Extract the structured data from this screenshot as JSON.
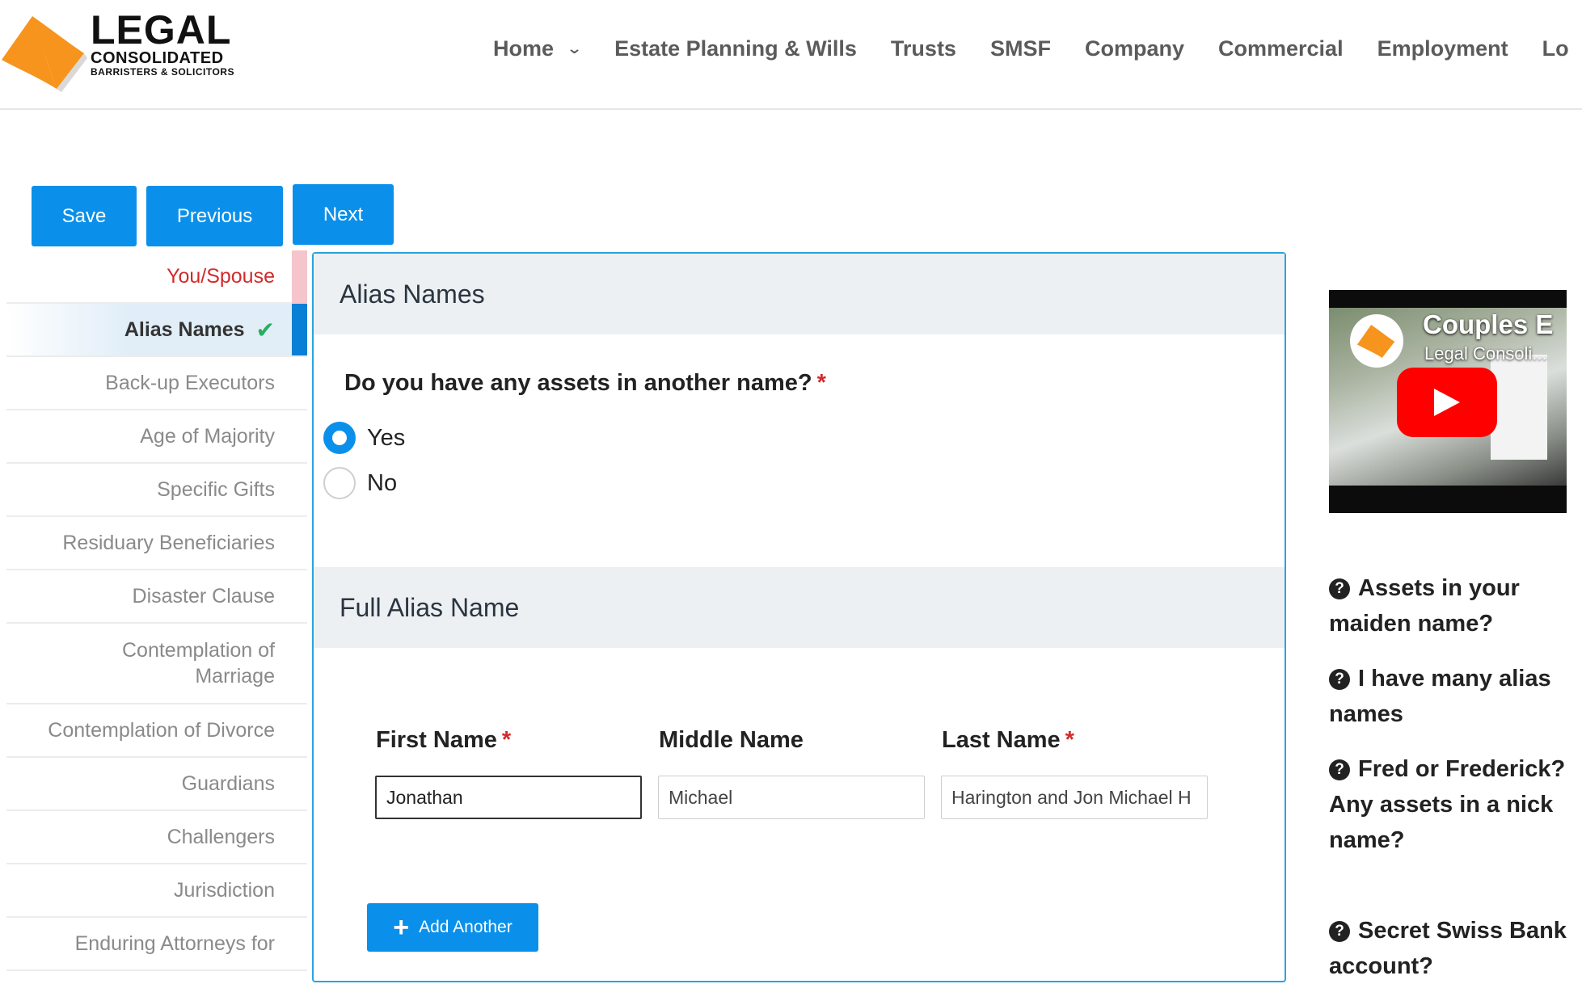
{
  "logo": {
    "line1": "LEGAL",
    "line2": "CONSOLIDATED",
    "line3": "BARRISTERS & SOLICITORS"
  },
  "nav": {
    "items": [
      {
        "label": "Home"
      },
      {
        "label": "Estate Planning & Wills"
      },
      {
        "label": "Trusts"
      },
      {
        "label": "SMSF"
      },
      {
        "label": "Company"
      },
      {
        "label": "Commercial"
      },
      {
        "label": "Employment"
      },
      {
        "label": "Lo"
      }
    ]
  },
  "toolbar": {
    "save_label": "Save",
    "previous_label": "Previous",
    "next_label": "Next"
  },
  "sidebar": {
    "items": [
      {
        "label": "You/Spouse"
      },
      {
        "label": "Alias Names"
      },
      {
        "label": "Back-up Executors"
      },
      {
        "label": "Age of Majority"
      },
      {
        "label": "Specific Gifts"
      },
      {
        "label": "Residuary Beneficiaries"
      },
      {
        "label": "Disaster Clause"
      },
      {
        "label": "Contemplation of Marriage"
      },
      {
        "label": "Contemplation of Divorce"
      },
      {
        "label": "Guardians"
      },
      {
        "label": "Challengers"
      },
      {
        "label": "Jurisdiction"
      },
      {
        "label": "Enduring Attorneys for"
      }
    ],
    "check_icon": "✔"
  },
  "form": {
    "section1_title": "Alias Names",
    "question": "Do you have any assets in another name?",
    "required_mark": "*",
    "options": [
      {
        "label": "Yes",
        "selected": true
      },
      {
        "label": "No",
        "selected": false
      }
    ],
    "section2_title": "Full Alias Name",
    "fields": [
      {
        "label": "First Name",
        "value": "Jonathan",
        "required": true
      },
      {
        "label": "Middle Name",
        "value": "Michael",
        "required": false
      },
      {
        "label": "Last Name",
        "value": "Harington and Jon Michael H",
        "required": true
      }
    ],
    "add_label": "Add Another"
  },
  "video": {
    "title": "Couples E",
    "subtitle": "Legal Consoli..."
  },
  "faq": {
    "icon": "?",
    "items": [
      {
        "label": "Assets in your maiden name?"
      },
      {
        "label": "I have many alias names"
      },
      {
        "label": "Fred or Frederick? Any assets in a nick name?"
      },
      {
        "label": "Secret Swiss Bank account?"
      }
    ]
  },
  "colors": {
    "primary": "#0a90ea",
    "active_bar": "#0a7fd6",
    "check": "#27ae60",
    "required": "#d22b2b",
    "logo_orange": "#f7941d"
  }
}
